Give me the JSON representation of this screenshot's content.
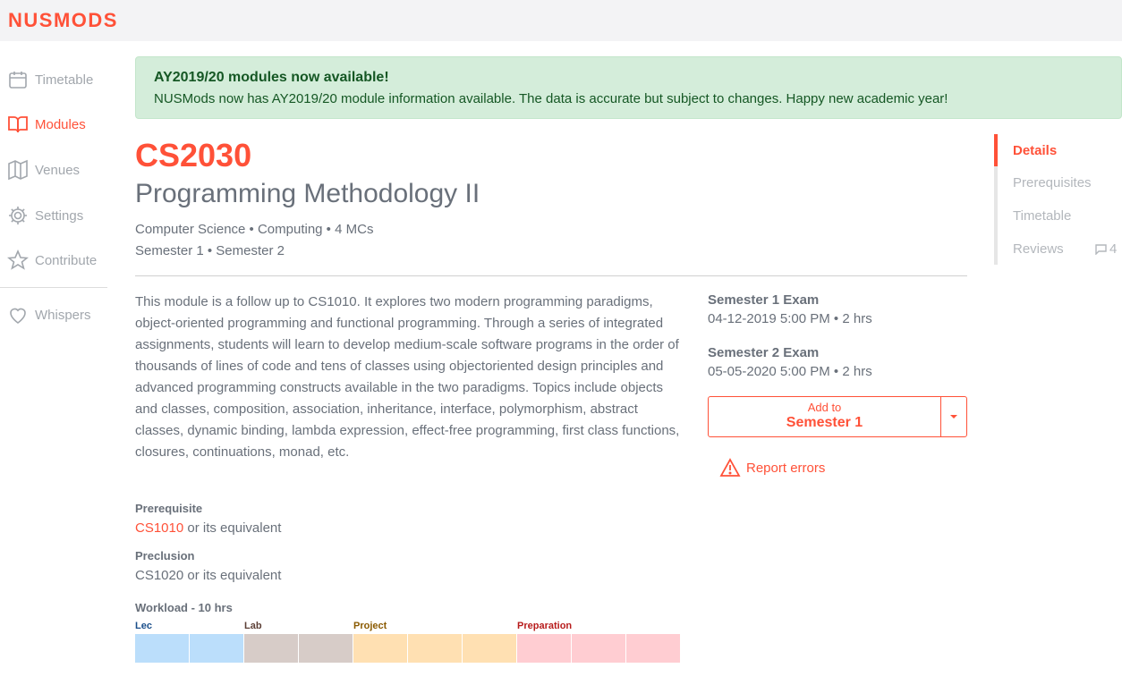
{
  "brand": "NUSMODS",
  "sidebar": {
    "items": [
      {
        "label": "Timetable",
        "icon": "calendar-icon"
      },
      {
        "label": "Modules",
        "icon": "book-icon"
      },
      {
        "label": "Venues",
        "icon": "map-icon"
      },
      {
        "label": "Settings",
        "icon": "gear-icon"
      },
      {
        "label": "Contribute",
        "icon": "star-icon"
      },
      {
        "label": "Whispers",
        "icon": "heart-icon"
      }
    ]
  },
  "alert": {
    "title": "AY2019/20 modules now available!",
    "text": "NUSMods now has AY2019/20 module information available. The data is accurate but subject to changes. Happy new academic year!"
  },
  "module": {
    "code": "CS2030",
    "title": "Programming Methodology II",
    "meta1": "Computer Science • Computing • 4 MCs",
    "meta2": "Semester 1 • Semester 2",
    "description": "This module is a follow up to CS1010. It explores two modern programming paradigms, object-oriented programming and functional programming. Through a series of integrated assignments, students will learn to develop medium-scale software programs in the order of thousands of lines of code and tens of classes using objectoriented design principles and advanced programming constructs available in the two paradigms. Topics include objects and classes, composition, association, inheritance, interface, polymorphism, abstract classes, dynamic binding, lambda expression, effect-free programming, first class functions, closures, continuations, monad, etc.",
    "prerequisite_label": "Prerequisite",
    "prerequisite_link": "CS1010",
    "prerequisite_rest": " or its equivalent",
    "preclusion_label": "Preclusion",
    "preclusion_text": "CS1020 or its equivalent",
    "workload_label": "Workload - 10 hrs",
    "workload": [
      {
        "label": "Lec",
        "hours": 2,
        "color": "#bbdefb",
        "label_color": "#1a4e8a"
      },
      {
        "label": "Lab",
        "hours": 2,
        "color": "#d7ccc8",
        "label_color": "#5d4037"
      },
      {
        "label": "Project",
        "hours": 3,
        "color": "#ffe0b2",
        "label_color": "#8a5a00"
      },
      {
        "label": "Preparation",
        "hours": 3,
        "color": "#ffcdd2",
        "label_color": "#b71c1c"
      }
    ]
  },
  "exams": [
    {
      "title": "Semester 1 Exam",
      "value": "04-12-2019 5:00 PM • 2 hrs"
    },
    {
      "title": "Semester 2 Exam",
      "value": "05-05-2020 5:00 PM • 2 hrs"
    }
  ],
  "add_button": {
    "small": "Add to",
    "big": "Semester 1"
  },
  "report_errors": "Report errors",
  "scrollspy": {
    "items": [
      "Details",
      "Prerequisites",
      "Timetable",
      "Reviews"
    ],
    "review_count": "4"
  },
  "colors": {
    "accent": "#ff5138",
    "alert_bg": "#d4edda",
    "alert_text": "#155724"
  }
}
